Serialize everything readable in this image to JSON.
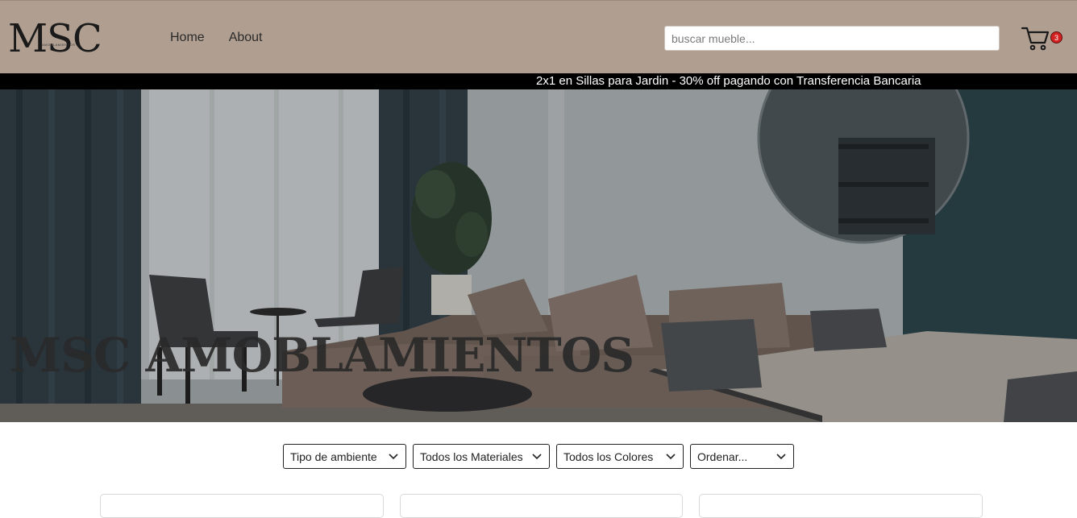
{
  "header": {
    "logo": "MSC",
    "logo_sub": "AMOBLAMIENTOS",
    "nav": [
      {
        "label": "Home"
      },
      {
        "label": "About"
      }
    ],
    "search": {
      "placeholder": "buscar mueble...",
      "value": ""
    },
    "cart": {
      "icon": "cart-icon",
      "count": "3"
    }
  },
  "promo": {
    "text": "2x1 en Sillas para Jardin - 30% off pagando con Transferencia Bancaria"
  },
  "hero": {
    "title": "MSC AMOBLAMIENTOS"
  },
  "filters": [
    {
      "label": "Tipo de ambiente"
    },
    {
      "label": "Todos los Materiales"
    },
    {
      "label": "Todos los Colores"
    },
    {
      "label": "Ordenar..."
    }
  ],
  "colors": {
    "header_bg": "#b09f91",
    "promo_bg": "#000000",
    "badge": "#d32020"
  }
}
